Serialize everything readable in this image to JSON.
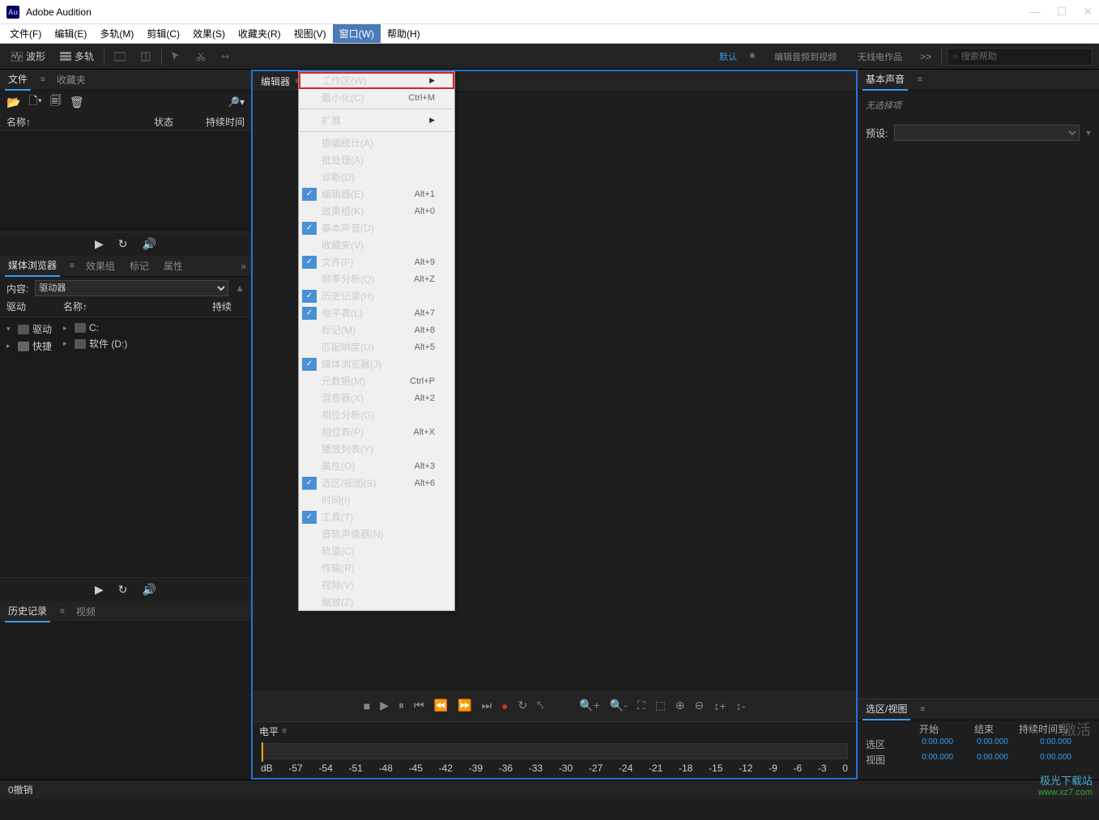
{
  "app": {
    "title": "Adobe Audition",
    "logo": "Au"
  },
  "winControls": {
    "min": "—",
    "max": "☐",
    "close": "✕"
  },
  "menuBar": [
    {
      "label": "文件(F)"
    },
    {
      "label": "编辑(E)"
    },
    {
      "label": "多轨(M)"
    },
    {
      "label": "剪辑(C)"
    },
    {
      "label": "效果(S)"
    },
    {
      "label": "收藏夹(R)"
    },
    {
      "label": "视图(V)"
    },
    {
      "label": "窗口(W)",
      "active": true
    },
    {
      "label": "帮助(H)"
    }
  ],
  "toolRow": {
    "waveform": "波形",
    "multitrack": "多轨",
    "workspaces": [
      {
        "label": "默认",
        "active": true
      },
      {
        "label": "编辑音频到视频"
      },
      {
        "label": "无线电作品"
      }
    ],
    "more": ">>",
    "searchPlaceholder": "搜索帮助"
  },
  "left": {
    "filesTabs": [
      {
        "label": "文件",
        "active": true
      },
      {
        "label": "收藏夹"
      }
    ],
    "filesHeader": {
      "name": "名称↑",
      "status": "状态",
      "duration": "持续时间"
    },
    "mediaTabs": [
      {
        "label": "媒体浏览器",
        "active": true
      },
      {
        "label": "效果组"
      },
      {
        "label": "标记"
      },
      {
        "label": "属性"
      }
    ],
    "contentLabel": "内容:",
    "contentSelect": "驱动器",
    "mediaHeader": {
      "drive": "驱动",
      "name": "名称↑",
      "dur": "持续"
    },
    "tree": [
      {
        "icon": "drive",
        "label": "C:",
        "indent": 1,
        "hasChildren": true
      },
      {
        "icon": "drive",
        "label": "软件 (D:)",
        "indent": 1,
        "hasChildren": true
      }
    ],
    "treeLeft": [
      {
        "icon": "drive",
        "label": "驱动",
        "hasChildren": true,
        "expanded": true
      },
      {
        "icon": "folder",
        "label": "快捷",
        "hasChildren": true,
        "indent": 0
      }
    ],
    "historyTabs": [
      {
        "label": "历史记录",
        "active": true
      },
      {
        "label": "视频"
      }
    ],
    "historyFooter": "0撤销"
  },
  "editor": {
    "tab": "编辑器"
  },
  "dropdown": [
    {
      "label": "工作区(W)",
      "submenu": true,
      "highlighted": true
    },
    {
      "label": "最小化(C)",
      "shortcut": "Ctrl+M"
    },
    {
      "sep": true
    },
    {
      "label": "扩展",
      "submenu": true
    },
    {
      "sep": true
    },
    {
      "label": "振幅统计(A)"
    },
    {
      "label": "批处理(A)"
    },
    {
      "label": "诊断(D)"
    },
    {
      "label": "编辑器(E)",
      "shortcut": "Alt+1",
      "checked": true
    },
    {
      "label": "效果组(K)",
      "shortcut": "Alt+0"
    },
    {
      "label": "基本声音(D)",
      "checked": true
    },
    {
      "label": "收藏夹(V)"
    },
    {
      "label": "文件(F)",
      "shortcut": "Alt+9",
      "checked": true
    },
    {
      "label": "频率分析(Q)",
      "shortcut": "Alt+Z"
    },
    {
      "label": "历史记录(H)",
      "checked": true
    },
    {
      "label": "电平表(L)",
      "shortcut": "Alt+7",
      "checked": true
    },
    {
      "label": "标记(M)",
      "shortcut": "Alt+8"
    },
    {
      "label": "匹配响度(U)",
      "shortcut": "Alt+5"
    },
    {
      "label": "媒体浏览器(J)",
      "checked": true
    },
    {
      "label": "元数据(M)",
      "shortcut": "Ctrl+P"
    },
    {
      "label": "混音器(X)",
      "shortcut": "Alt+2"
    },
    {
      "label": "相位分析(G)"
    },
    {
      "label": "相位表(P)",
      "shortcut": "Alt+X"
    },
    {
      "label": "播放列表(Y)"
    },
    {
      "label": "属性(O)",
      "shortcut": "Alt+3"
    },
    {
      "label": "选区/视图(S)",
      "shortcut": "Alt+6",
      "checked": true
    },
    {
      "label": "时间(I)"
    },
    {
      "label": "工具(T)",
      "checked": true
    },
    {
      "label": "音轨声像器(N)"
    },
    {
      "label": "轨道(C)"
    },
    {
      "label": "传输(R)"
    },
    {
      "label": "视频(V)"
    },
    {
      "label": "缩放(Z)"
    }
  ],
  "level": {
    "tab": "电平",
    "scale": [
      "dB",
      "-57",
      "-54",
      "-51",
      "-48",
      "-45",
      "-42",
      "-39",
      "-36",
      "-33",
      "-30",
      "-27",
      "-24",
      "-21",
      "-18",
      "-15",
      "-12",
      "-9",
      "-6",
      "-3",
      "0"
    ]
  },
  "right": {
    "soundTab": "基本声音",
    "noSelection": "无选择项",
    "presetLabel": "预设:",
    "selTab": "选区/视图",
    "selHdr": {
      "start": "开始",
      "end": "结束",
      "dur": "持续时间到"
    },
    "selRows": [
      {
        "lbl": "选区",
        "v1": "0:00.000",
        "v2": "0:00.000",
        "v3": "0:00.000"
      },
      {
        "lbl": "视图",
        "v1": "0:00.000",
        "v2": "0:00.000",
        "v3": "0:00.000"
      }
    ],
    "activate": "激活"
  },
  "statusBar": {
    "undo": "0撤销"
  },
  "watermark": {
    "line1": "极光下载站",
    "line2": "www.xz7.com"
  }
}
